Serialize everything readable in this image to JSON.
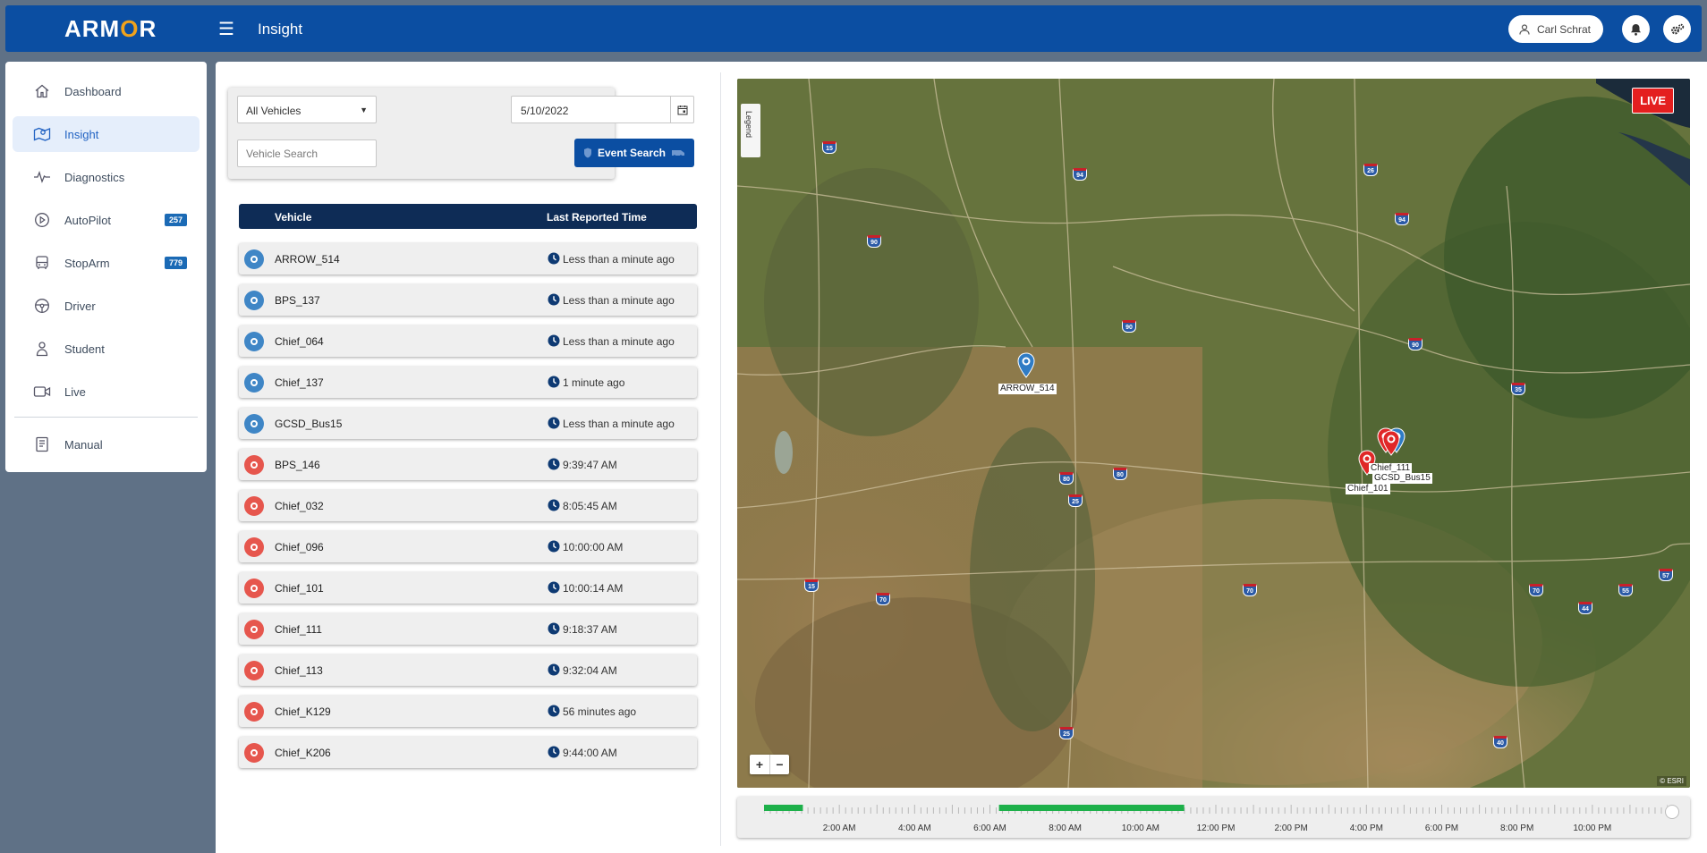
{
  "app": {
    "logo_text_a": "ARM",
    "logo_text_o": "O",
    "logo_text_b": "R",
    "page_title": "Insight",
    "user_name": "Carl Schrat"
  },
  "sidebar": {
    "items": [
      {
        "label": "Dashboard",
        "icon": "home-icon"
      },
      {
        "label": "Insight",
        "icon": "map-icon",
        "active": true
      },
      {
        "label": "Diagnostics",
        "icon": "pulse-icon"
      },
      {
        "label": "AutoPilot",
        "icon": "play-circle-icon",
        "badge": "257"
      },
      {
        "label": "StopArm",
        "icon": "bus-icon",
        "badge": "779"
      },
      {
        "label": "Driver",
        "icon": "steering-wheel-icon"
      },
      {
        "label": "Student",
        "icon": "student-icon"
      },
      {
        "label": "Live",
        "icon": "video-icon"
      },
      {
        "label": "Manual",
        "icon": "book-icon"
      }
    ]
  },
  "filters": {
    "vehicle_select": "All Vehicles",
    "date": "5/10/2022",
    "vehicle_search_placeholder": "Vehicle Search",
    "event_search_label": "Event Search"
  },
  "table": {
    "col_vehicle": "Vehicle",
    "col_time": "Last Reported Time",
    "rows": [
      {
        "name": "ARROW_514",
        "time": "Less than a minute ago",
        "status": "online"
      },
      {
        "name": "BPS_137",
        "time": "Less than a minute ago",
        "status": "online"
      },
      {
        "name": "Chief_064",
        "time": "Less than a minute ago",
        "status": "online"
      },
      {
        "name": "Chief_137",
        "time": "1 minute ago",
        "status": "online"
      },
      {
        "name": "GCSD_Bus15",
        "time": "Less than a minute ago",
        "status": "online"
      },
      {
        "name": "BPS_146",
        "time": "9:39:47 AM",
        "status": "offline"
      },
      {
        "name": "Chief_032",
        "time": "8:05:45 AM",
        "status": "offline"
      },
      {
        "name": "Chief_096",
        "time": "10:00:00 AM",
        "status": "offline"
      },
      {
        "name": "Chief_101",
        "time": "10:00:14 AM",
        "status": "offline"
      },
      {
        "name": "Chief_111",
        "time": "9:18:37 AM",
        "status": "offline"
      },
      {
        "name": "Chief_113",
        "time": "9:32:04 AM",
        "status": "offline"
      },
      {
        "name": "Chief_K129",
        "time": "56 minutes ago",
        "status": "offline"
      },
      {
        "name": "Chief_K206",
        "time": "9:44:00 AM",
        "status": "offline"
      }
    ]
  },
  "map": {
    "live_label": "LIVE",
    "legend_label": "Legend",
    "zoom_in": "+",
    "zoom_out": "−",
    "attribution": "© ESRI",
    "markers": [
      {
        "label": "ARROW_514",
        "color": "blue"
      },
      {
        "label": "Chief_111",
        "color": "red"
      },
      {
        "label": "GCSD_Bus15",
        "color": "blue"
      },
      {
        "label": "Chief_101",
        "color": "red"
      }
    ],
    "highway_shields": [
      "15",
      "94",
      "26",
      "94",
      "90",
      "90",
      "90",
      "35",
      "80",
      "80",
      "25",
      "15",
      "70",
      "70",
      "70",
      "55",
      "57",
      "44",
      "25",
      "40"
    ]
  },
  "timeline": {
    "labels": [
      "2:00 AM",
      "4:00 AM",
      "6:00 AM",
      "8:00 AM",
      "10:00 AM",
      "12:00 PM",
      "2:00 PM",
      "4:00 PM",
      "6:00 PM",
      "8:00 PM",
      "10:00 PM"
    ]
  },
  "colors": {
    "primary": "#0b4ea2",
    "header_dark": "#0e2c56",
    "online": "#3f86c6",
    "offline": "#e6564d",
    "live": "#e41f1f",
    "timeline_active": "#1db04a"
  }
}
